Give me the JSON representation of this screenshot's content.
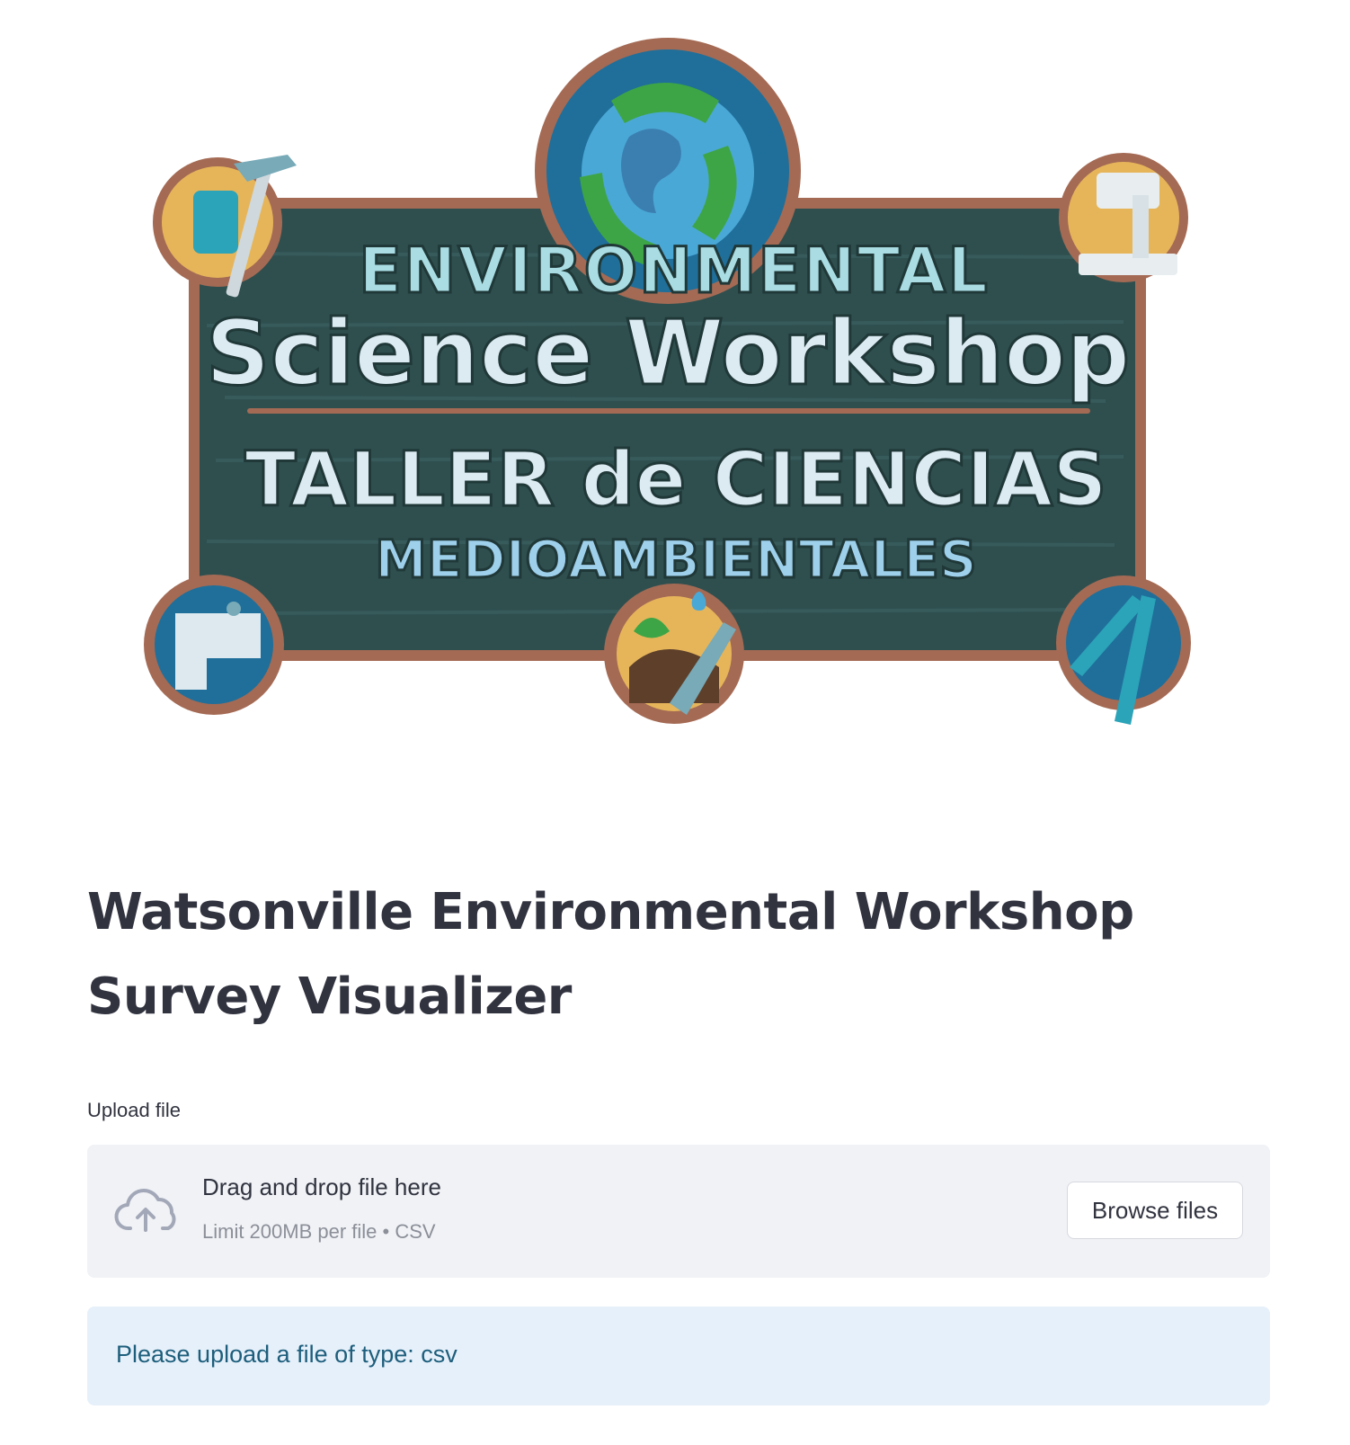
{
  "banner": {
    "logo_lines": [
      "ENVIRONMENTAL",
      "Science Workshop",
      "TALLER de CIENCIAS",
      "MEDIOAMBIENTALES"
    ],
    "colors": {
      "board": "#2f4f4f",
      "frame": "#a46a54",
      "text_light": "#dcebf2",
      "text_teal": "#a9dde3",
      "text_blue": "#9ed0ec"
    }
  },
  "page_title": "Watsonville Environmental Workshop Survey Visualizer",
  "uploader": {
    "label": "Upload file",
    "drop_title": "Drag and drop file here",
    "drop_subtitle": "Limit 200MB per file • CSV",
    "browse_label": "Browse files",
    "icon": "cloud-upload-icon"
  },
  "info": {
    "message": "Please upload a file of type: csv"
  },
  "colors": {
    "dropzone_bg": "#f0f2f6",
    "info_bg": "#e6f0fa",
    "info_text": "#1d5e7c"
  }
}
